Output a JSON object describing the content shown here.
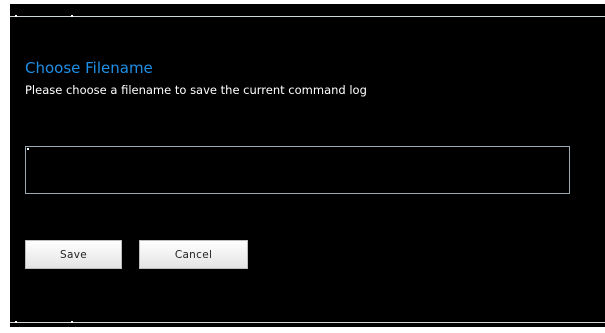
{
  "dialog": {
    "title": "Choose Filename",
    "subtitle": "Please choose a filename to save the current command log",
    "filename_input": {
      "value": "",
      "placeholder": ""
    },
    "buttons": {
      "save_label": "Save",
      "cancel_label": "Cancel"
    }
  },
  "colors": {
    "background": "#000000",
    "title": "#1f8fe6",
    "text": "#ffffff",
    "input_border": "#9aa8b2",
    "button_bg": "#f0f0f0"
  }
}
